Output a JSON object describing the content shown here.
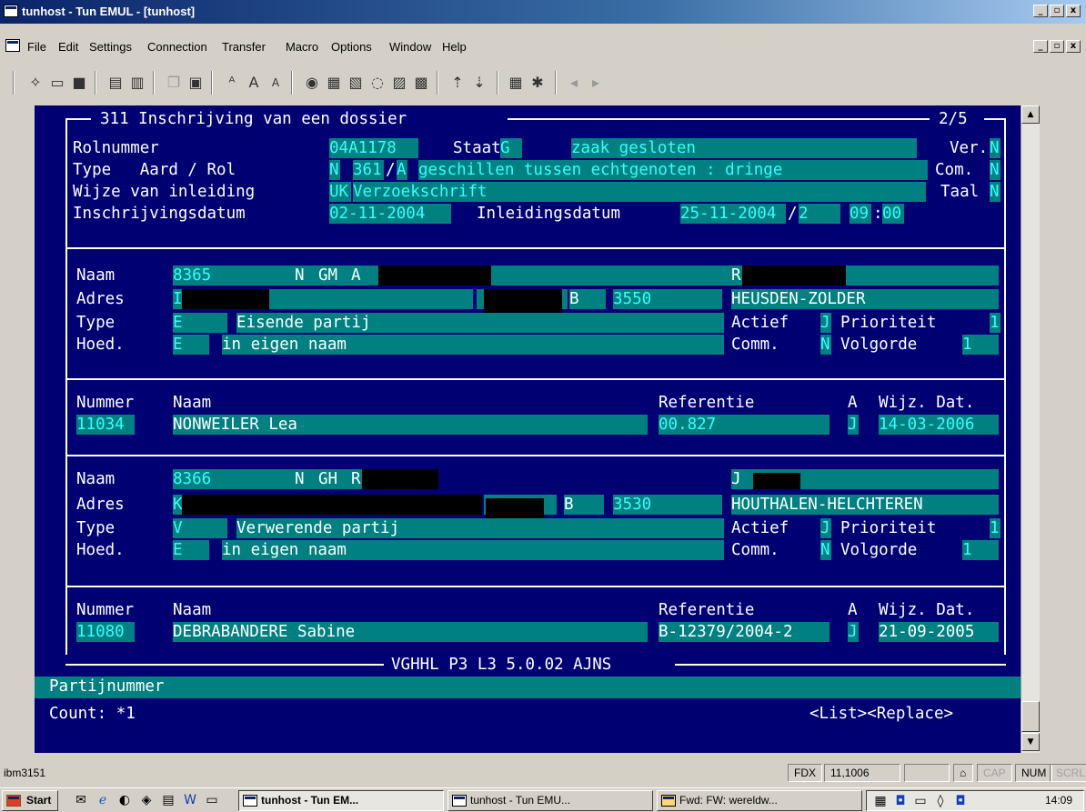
{
  "window": {
    "title": "tunhost - Tun EMUL - [tunhost]",
    "min": "_",
    "max": "ð",
    "close": "x"
  },
  "menu": [
    "File",
    "Edit",
    "Settings",
    "Connection",
    "Transfer",
    "Macro",
    "Options",
    "Window",
    "Help"
  ],
  "toolbar": {
    "prev": "◂",
    "next": "▸"
  },
  "header": {
    "title": "311 Inschrijving van een dossier",
    "page": "2/5",
    "rol_label": "Rolnummer",
    "rol": "04A1178",
    "staat_label": "Staat",
    "staat_code": "G",
    "staat_text": "zaak gesloten",
    "ver_label": "Ver.",
    "ver": "N",
    "type_label": "Type   Aard / Rol",
    "type_code": "N",
    "aard": "361",
    "slash": "/",
    "rol_code": "A",
    "type_text": "geschillen tussen echtgenoten : dringe",
    "com_label": "Com.",
    "com": "N",
    "wijze_label": "Wijze van inleiding",
    "wijze_code": "UK",
    "wijze_text": "Verzoekschrift",
    "taal_label": "Taal",
    "taal": "N",
    "datum_label": "Inschrijvingsdatum",
    "datum": "02-11-2004",
    "inl_label": "Inleidingsdatum",
    "inl": "25-11-2004",
    "inl_suffix": "2",
    "hour": "09",
    "colon": ":",
    "min": "00"
  },
  "labels": {
    "naam": "Naam",
    "adres": "Adres",
    "type": "Type",
    "hoed": "Hoed.",
    "actief": "Actief",
    "prioriteit": "Prioriteit",
    "comm": "Comm.",
    "volgorde": "Volgorde",
    "nummer": "Nummer",
    "referentie": "Referentie",
    "a": "A",
    "wijz": "Wijz. Dat."
  },
  "party1": {
    "nr": "8365",
    "nm": "N",
    "gm": "GM",
    "init": "A",
    "first": "R",
    "addr": "I",
    "country": "B",
    "zip": "3550",
    "city": "HEUSDEN-ZOLDER",
    "type_code": "E",
    "type_text": "Eisende partij",
    "actief": "J",
    "prio": "1",
    "hoed_code": "E",
    "hoed_text": "in eigen naam",
    "comm": "N",
    "volg": "1"
  },
  "lawyer1": {
    "nummer": "11034",
    "naam": "NONWEILER Lea",
    "ref": "00.827",
    "a": "J",
    "datum": "14-03-2006"
  },
  "party2": {
    "nr": "8366",
    "nm": "N",
    "gm": "GH",
    "init": "R",
    "first": "J",
    "addr": "K",
    "country": "B",
    "zip": "3530",
    "city": "HOUTHALEN-HELCHTEREN",
    "type_code": "V",
    "type_text": "Verwerende partij",
    "actief": "J",
    "prio": "1",
    "hoed_code": "E",
    "hoed_text": "in eigen naam",
    "comm": "N",
    "volg": "1"
  },
  "lawyer2": {
    "nummer": "11080",
    "naam": "DEBRABANDERE Sabine",
    "ref": "B-12379/2004-2",
    "a": "J",
    "datum": "21-09-2005"
  },
  "footer_title": "VGHHL P3 L3 5.0.02 AJNS",
  "prompt": "Partijnummer",
  "count": "Count: *1",
  "cmds": "<List><Replace>",
  "status": {
    "host": "ibm3151",
    "fdx": "FDX",
    "pos": "11,1006",
    "cap": "CAP",
    "num": "NUM",
    "scrl": "SCRL"
  },
  "taskbar": {
    "start": "Start",
    "tasks": [
      "tunhost - Tun EM...",
      "tunhost - Tun EMU...",
      "Fwd: FW: wereldw..."
    ],
    "clock": "14:09"
  }
}
